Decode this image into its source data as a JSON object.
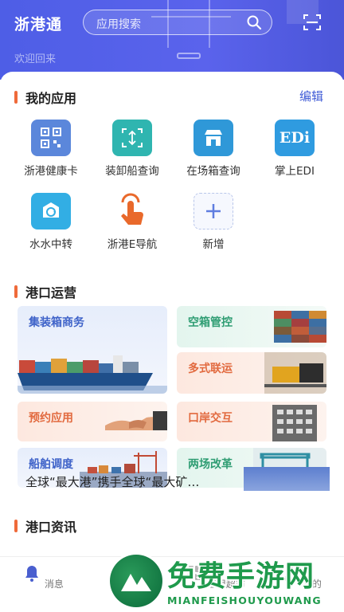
{
  "header": {
    "app_title": "浙港通",
    "search_placeholder": "应用搜索",
    "welcome": "欢迎回来",
    "colors": {
      "primary": "#4e5ee6",
      "accent": "#ef6a3a",
      "link": "#3f5bd6"
    }
  },
  "my_apps": {
    "title": "我的应用",
    "edit_label": "编辑",
    "items": [
      {
        "label": "浙港健康卡",
        "icon": "qr-code-icon"
      },
      {
        "label": "装卸船查询",
        "icon": "scan-ship-icon"
      },
      {
        "label": "在场箱查询",
        "icon": "store-icon"
      },
      {
        "label": "掌上EDI",
        "icon": "edi-icon"
      },
      {
        "label": "水水中转",
        "icon": "transfer-icon"
      },
      {
        "label": "浙港E导航",
        "icon": "touch-hand-icon"
      },
      {
        "label": "新增",
        "icon": "plus-icon"
      }
    ]
  },
  "port_ops": {
    "title": "港口运营",
    "tiles": [
      {
        "label": "集装箱商务"
      },
      {
        "label": "空箱管控"
      },
      {
        "label": "多式联运"
      },
      {
        "label": "预约应用"
      },
      {
        "label": "口岸交互"
      },
      {
        "label": "船舶调度"
      },
      {
        "label": "两场改革"
      }
    ]
  },
  "news": {
    "title": "港口资讯",
    "headline": "全球“最大港”携手全球“最大矿…"
  },
  "bottom_nav": {
    "items": [
      {
        "label": "消息",
        "icon": "bell-icon"
      },
      {
        "label": "",
        "icon": "home-icon"
      },
      {
        "label": "应用超市",
        "icon": "grid-icon"
      },
      {
        "label": "我的",
        "icon": "user-icon"
      }
    ]
  },
  "watermark": {
    "text": "免费手游网",
    "sub": "MIANFEISHOUYOUWANG"
  }
}
